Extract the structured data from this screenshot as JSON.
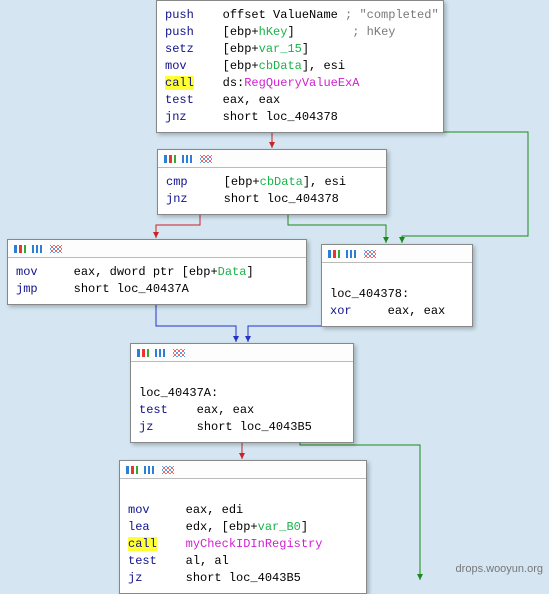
{
  "watermark": "drops.wooyun.org",
  "node0": {
    "l1_op": "push",
    "l1_a1": "offset ValueName ",
    "l1_cm": "; \"completed\"",
    "l2_op": "push",
    "l2_a1": "[ebp+",
    "l2_v": "hKey",
    "l2_a2": "]",
    "l2_cm": "; hKey",
    "l3_op": "setz",
    "l3_a1": "[ebp+",
    "l3_v": "var_15",
    "l3_a2": "]",
    "l4_op": "mov",
    "l4_a1": "[ebp+",
    "l4_v": "cbData",
    "l4_a2": "], esi",
    "l5_op": "call",
    "l5_a1": "ds:",
    "l5_fn": "RegQueryValueExA",
    "l6_op": "test",
    "l6_a1": "eax, eax",
    "l7_op": "jnz",
    "l7_a1": "short loc_404378"
  },
  "node1": {
    "l1_op": "cmp",
    "l1_a1": "[ebp+",
    "l1_v": "cbData",
    "l1_a2": "], esi",
    "l2_op": "jnz",
    "l2_a1": "short loc_404378"
  },
  "node2": {
    "l1_op": "mov",
    "l1_a1": "eax, dword ptr [ebp+",
    "l1_v": "Data",
    "l1_a2": "]",
    "l2_op": "jmp",
    "l2_a1": "short loc_40437A"
  },
  "node3": {
    "l1_lbl": "loc_404378:",
    "l2_op": "xor",
    "l2_a1": "eax, eax"
  },
  "node4": {
    "l1_lbl": "loc_40437A:",
    "l2_op": "test",
    "l2_a1": "eax, eax",
    "l3_op": "jz",
    "l3_a1": "short loc_4043B5"
  },
  "node5": {
    "l1_op": "mov",
    "l1_a1": "eax, edi",
    "l2_op": "lea",
    "l2_a1": "edx, [ebp+",
    "l2_v": "var_B0",
    "l2_a2": "]",
    "l3_op": "call",
    "l3_fn": "myCheckIDInRegistry",
    "l4_op": "test",
    "l4_a1": "al, al",
    "l5_op": "jz",
    "l5_a1": "short loc_4043B5"
  }
}
